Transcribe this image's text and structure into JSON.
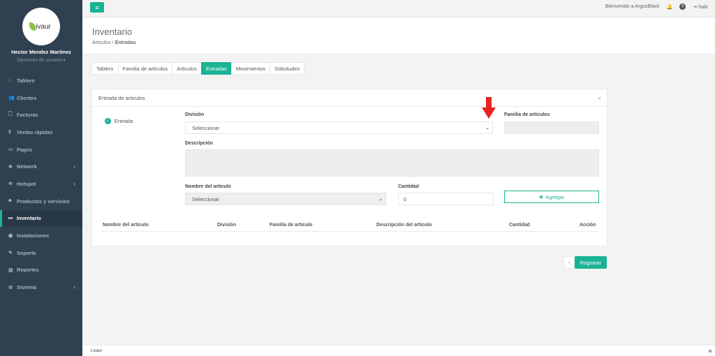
{
  "sidebar": {
    "logo_text": "ivaur",
    "user_name": "Hector Mendez Martinez",
    "user_options": "Opciones de usuario ▾",
    "items": [
      {
        "label": "Tablero",
        "icon": "⌂"
      },
      {
        "label": "Clientes",
        "icon": "👥"
      },
      {
        "label": "Facturas",
        "icon": "🗋"
      },
      {
        "label": "Ventas rápidas",
        "icon": "$"
      },
      {
        "label": "Pagos",
        "icon": "▭"
      },
      {
        "label": "Network",
        "icon": "❄",
        "chevron": "‹"
      },
      {
        "label": "Hotspot",
        "icon": "≋",
        "chevron": "‹"
      },
      {
        "label": "Productos y servicios",
        "icon": "⬥"
      },
      {
        "label": "Inventario",
        "icon": "⚯"
      },
      {
        "label": "Instalaciones",
        "icon": "⬢"
      },
      {
        "label": "Soporte",
        "icon": "✎"
      },
      {
        "label": "Reportes",
        "icon": "▤"
      },
      {
        "label": "Sistema",
        "icon": "⚙",
        "chevron": "‹"
      }
    ]
  },
  "topbar": {
    "menu_icon": "≡",
    "welcome": "Bienvenido a ArgusBlack",
    "bell_icon": "🔔",
    "help_icon": "?",
    "logout_icon": "⇥",
    "logout_label": "Salir"
  },
  "heading": {
    "title": "Inventario",
    "crumb_parent": "Articulos",
    "crumb_sep": " / ",
    "crumb_current": "Entradas"
  },
  "tabs": [
    "Tablero",
    "Familia de articulos",
    "Articulos",
    "Entradas",
    "Movimientos",
    "Solicitudes"
  ],
  "panel": {
    "title": "Entrada de articulos",
    "close": "×",
    "entry_check": "✓",
    "entry_label": "Entrada",
    "division_label": "División",
    "division_value": "Seleccionar",
    "familia_label": "Familia de articulos",
    "familia_value": "",
    "descripcion_label": "Descripción",
    "nombre_label": "Nombre del articulo",
    "nombre_value": "Seleccionar",
    "cantidad_label": "Cantidad",
    "cantidad_value": "0",
    "add_icon": "✚",
    "add_label": "Agregar",
    "caret": "⌄",
    "table_headers": [
      "Nombre del articulo",
      "División",
      "Familia de articulo",
      "Descripción del articulo",
      "Cantidad",
      "Acción"
    ]
  },
  "actions": {
    "prev": "‹",
    "register": "Registrar"
  },
  "footer": {
    "text": "Livaur",
    "icon": "≣"
  },
  "colors": {
    "accent": "#1ab394",
    "sidebar": "#2f4050",
    "arrow": "#e8231f"
  }
}
